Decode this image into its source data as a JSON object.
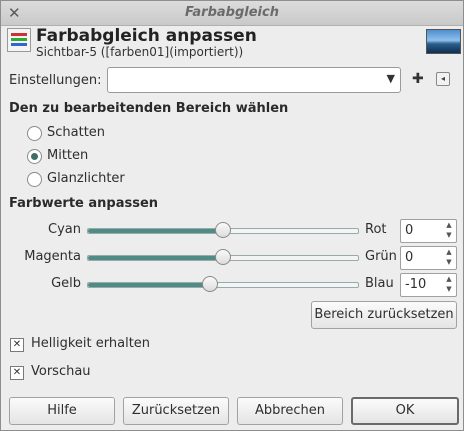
{
  "window": {
    "title": "Farbabgleich",
    "close_glyph": "✕"
  },
  "header": {
    "title": "Farbabgleich anpassen",
    "subtitle": "Sichtbar-5 ([farben01](importiert))"
  },
  "presets": {
    "label": "Einstellungen:",
    "value": "",
    "add_glyph": "✚",
    "menu_glyph": "◂"
  },
  "range": {
    "heading": "Den zu bearbeitenden Bereich wählen",
    "options": [
      {
        "label": "Schatten",
        "selected": false
      },
      {
        "label": "Mitten",
        "selected": true
      },
      {
        "label": "Glanzlichter",
        "selected": false
      }
    ]
  },
  "adjust": {
    "heading": "Farbwerte anpassen",
    "sliders": [
      {
        "left": "Cyan",
        "right": "Rot",
        "value": "0",
        "level": 0
      },
      {
        "left": "Magenta",
        "right": "Grün",
        "value": "0",
        "level": 0
      },
      {
        "left": "Gelb",
        "right": "Blau",
        "value": "-10",
        "level": -10
      }
    ],
    "range_min": -100,
    "range_max": 100,
    "reset_range_label": "Bereich zurücksetzen"
  },
  "options": {
    "preserve_luminosity": {
      "label": "Helligkeit erhalten",
      "checked": true
    },
    "preview": {
      "label": "Vorschau",
      "checked": true
    }
  },
  "buttons": {
    "help": "Hilfe",
    "reset": "Zurücksetzen",
    "cancel": "Abbrechen",
    "ok": "OK"
  },
  "colors": {
    "accent": "#4f8c85"
  }
}
